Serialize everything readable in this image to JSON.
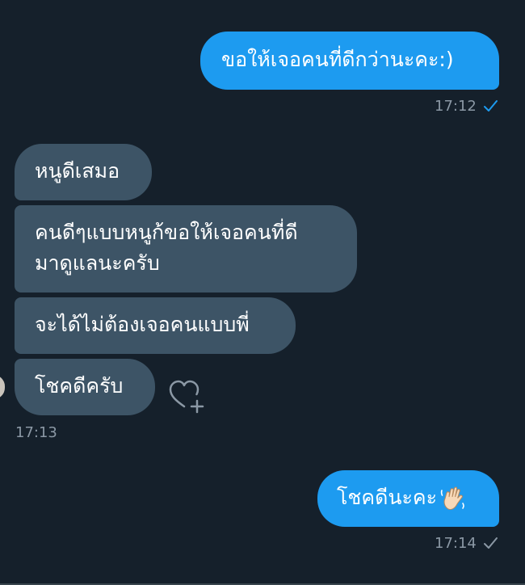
{
  "conversation": {
    "messages": [
      {
        "direction": "outgoing",
        "text": "ขอให้เจอคนที่ดีกว่านะคะ:)"
      },
      {
        "direction": "incoming",
        "text": "หนูดีเสมอ"
      },
      {
        "direction": "incoming",
        "text_lines": [
          "คนดีๆแบบหนูก้ขอให้เจอคนที่ดี",
          "มาดูแลนะครับ"
        ]
      },
      {
        "direction": "incoming",
        "text": "จะได้ไม่ต้องเจอคนแบบพี่"
      },
      {
        "direction": "incoming",
        "text": "โชคดีครับ"
      },
      {
        "direction": "outgoing",
        "text": "โชคดีนะคะ",
        "emoji": "waving-hand-icon"
      }
    ],
    "timestamps": [
      "17:12",
      "17:13",
      "17:14"
    ],
    "read_receipts": [
      {
        "time": "17:12",
        "status": "sent",
        "color": "#1d9bf0"
      },
      {
        "time": "17:14",
        "status": "sent",
        "color": "#8b98a5"
      }
    ]
  },
  "colors": {
    "background": "#15202b",
    "outgoing_bubble": "#1d9bf0",
    "incoming_bubble": "#3d5466",
    "timestamp": "#8b98a5"
  }
}
